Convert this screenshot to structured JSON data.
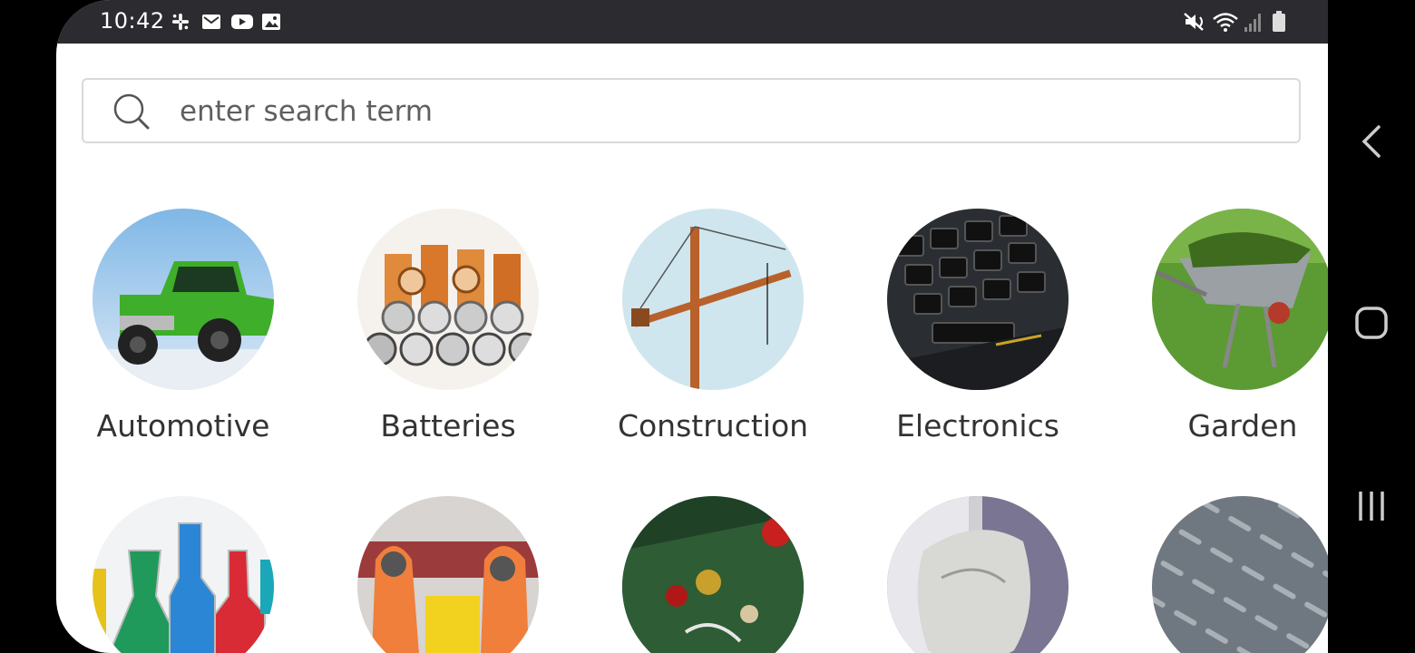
{
  "status_bar": {
    "time": "10:42",
    "notification_icons": [
      "slack-icon",
      "gmail-icon",
      "youtube-icon",
      "gallery-icon"
    ],
    "system_icons": [
      "mute-icon",
      "wifi-icon",
      "signal-icon",
      "battery-icon"
    ]
  },
  "search": {
    "placeholder": "enter search term",
    "value": ""
  },
  "categories": [
    {
      "label": "Automotive",
      "icon": "truck-image"
    },
    {
      "label": "Batteries",
      "icon": "batteries-image"
    },
    {
      "label": "Construction",
      "icon": "crane-image"
    },
    {
      "label": "Electronics",
      "icon": "keyboard-image"
    },
    {
      "label": "Garden",
      "icon": "wheelbarrow-image"
    },
    {
      "label": "",
      "icon": "chemicals-image"
    },
    {
      "label": "",
      "icon": "hazmat-image"
    },
    {
      "label": "",
      "icon": "christmas-tree-image"
    },
    {
      "label": "",
      "icon": "plastic-bag-image"
    },
    {
      "label": "",
      "icon": "metal-plate-image"
    }
  ],
  "nav_bar": {
    "buttons": [
      "back-icon",
      "home-icon",
      "recents-icon"
    ]
  }
}
